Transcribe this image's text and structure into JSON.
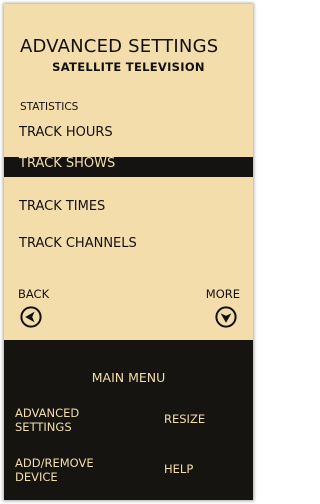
{
  "header": {
    "title": "ADVANCED SETTINGS",
    "subtitle": "SATELLITE TELEVISION"
  },
  "section": {
    "label": "STATISTICS"
  },
  "menu": {
    "items": [
      {
        "label": "TRACK HOURS",
        "selected": false
      },
      {
        "label": "TRACK SHOWS",
        "selected": true
      },
      {
        "label": "TRACK TIMES",
        "selected": false
      },
      {
        "label": "TRACK CHANNELS",
        "selected": false
      }
    ]
  },
  "nav": {
    "back_label": "BACK",
    "back_icon": "arrow-left-circle-icon",
    "more_label": "MORE",
    "more_icon": "arrow-down-circle-icon"
  },
  "main_menu": {
    "title": "MAIN MENU",
    "advanced_settings_line1": "ADVANCED",
    "advanced_settings_line2": "SETTINGS",
    "resize_label": "RESIZE",
    "add_remove_line1": "ADD/REMOVE",
    "add_remove_line2": "DEVICE",
    "help_label": "HELP"
  },
  "colors": {
    "background": "#f3ddaa",
    "text": "#111111",
    "panel": "#151411",
    "highlight": "#141312"
  }
}
